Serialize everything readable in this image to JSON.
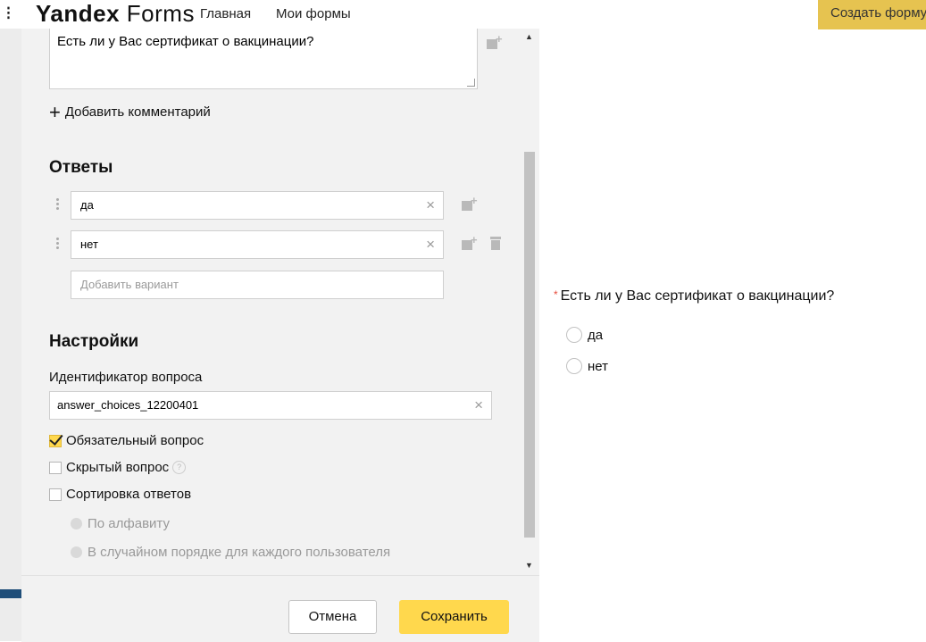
{
  "topbar": {
    "logo_bold": "Yandex",
    "logo_light": " Forms",
    "nav": [
      "Главная",
      "Мои формы"
    ],
    "create_button": "Создать форму"
  },
  "editor": {
    "question_text": "Есть ли у Вас сертификат о вакцинации?",
    "add_comment": "Добавить комментарий",
    "answers_title": "Ответы",
    "answers": [
      "да",
      "нет"
    ],
    "add_variant_placeholder": "Добавить вариант",
    "settings_title": "Настройки",
    "question_id_label": "Идентификатор вопроса",
    "question_id_value": "answer_choices_12200401",
    "required_label": "Обязательный вопрос",
    "required_checked": true,
    "hidden_label": "Скрытый вопрос",
    "hidden_checked": false,
    "sort_label": "Сортировка ответов",
    "sort_checked": false,
    "sort_options": [
      "По алфавиту",
      "В случайном порядке для каждого пользователя"
    ],
    "help_icon_text": "?",
    "clear_glyph": "×",
    "plus_glyph": "+"
  },
  "footer": {
    "cancel": "Отмена",
    "save": "Сохранить"
  },
  "preview": {
    "required_mark": "*",
    "question": "Есть ли у Вас сертификат о вакцинации?",
    "options": [
      "да",
      "нет"
    ]
  },
  "colors": {
    "accent": "#ffd84d",
    "create_button": "#e6c350",
    "required": "#e74c3c",
    "panel_bg": "#f2f2f2"
  }
}
